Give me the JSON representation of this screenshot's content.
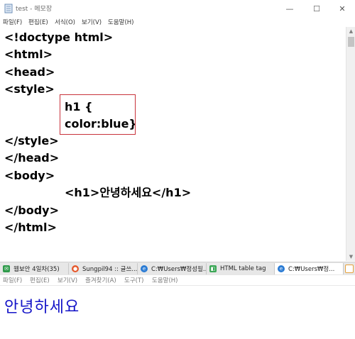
{
  "notepad": {
    "title": "test - 메모장",
    "menu": [
      "파일(F)",
      "편집(E)",
      "서식(O)",
      "보기(V)",
      "도움말(H)"
    ],
    "controls": {
      "minimize": "—",
      "maximize": "☐",
      "close": "✕"
    },
    "code_lines": [
      "<!doctype html>",
      "<html>",
      "<head>",
      "<style>",
      "h1 {",
      "color:blue}",
      "</style>",
      "</head>",
      "<body>",
      "<h1>안녕하세요</h1>",
      "</body>",
      "</html>"
    ],
    "highlight_color": "#c8333b"
  },
  "taskbar": {
    "tabs": [
      {
        "label": "웹보안 4일차(35)",
        "icon": "mail-icon",
        "icon_color": "#2e9a4a",
        "active": false
      },
      {
        "label": "Sungpil94 :: 글쓰...",
        "icon": "blog-icon",
        "icon_color": "#e5582b",
        "active": false
      },
      {
        "label": "C:₩Users₩정성필...",
        "icon": "ie-icon",
        "icon_color": "#2a7bd4",
        "active": false
      },
      {
        "label": "HTML table tag",
        "icon": "web-icon",
        "icon_color": "#3aa655",
        "active": false
      },
      {
        "label": "C:₩Users₩정...",
        "icon": "ie-icon",
        "icon_color": "#2a7bd4",
        "active": true
      }
    ]
  },
  "browser": {
    "menu": [
      "파일(F)",
      "편집(E)",
      "보기(V)",
      "즐겨찾기(A)",
      "도구(T)",
      "도움말(H)"
    ],
    "rendered_heading": "안녕하세요",
    "heading_color": "#1414c8"
  }
}
